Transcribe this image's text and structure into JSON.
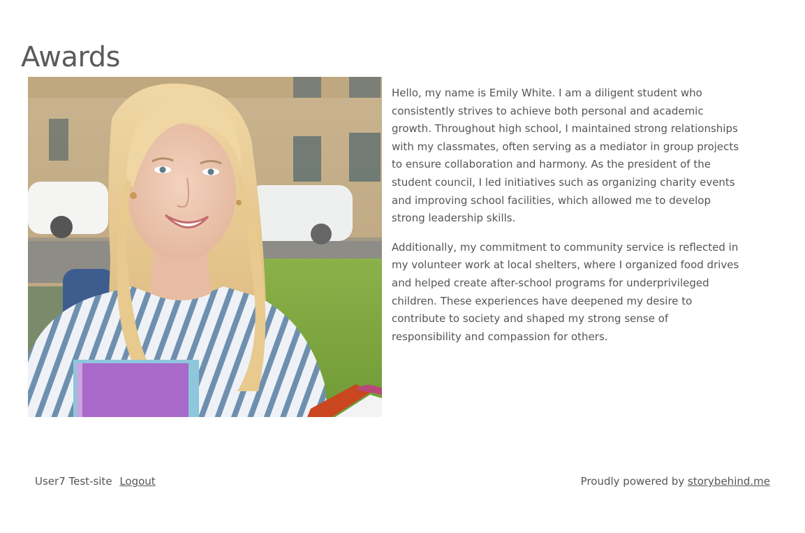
{
  "page": {
    "title": "Awards"
  },
  "photo": {
    "subject": "smiling student with books"
  },
  "bio": {
    "paragraphs": [
      "Hello, my name is Emily White. I am a diligent student who consistently strives to achieve both personal and academic growth. Throughout high school, I maintained strong relationships with my classmates, often serving as a mediator in group projects to ensure collaboration and harmony. As the president of the student council, I led initiatives such as organizing charity events and improving school facilities, which allowed me to develop strong leadership skills.",
      "Additionally, my commitment to community service is reflected in my volunteer work at local shelters, where I organized food drives and helped create after-school programs for underprivileged children. These experiences have deepened my desire to contribute to society and shaped my strong sense of responsibility and compassion for others."
    ]
  },
  "footer": {
    "site_name": "User7 Test-site",
    "logout_label": "Logout",
    "powered_prefix": "Proudly powered by",
    "powered_link": "storybehind.me"
  },
  "colors": {
    "text": "#555555",
    "title": "#5a5a5a",
    "background": "#ffffff"
  }
}
